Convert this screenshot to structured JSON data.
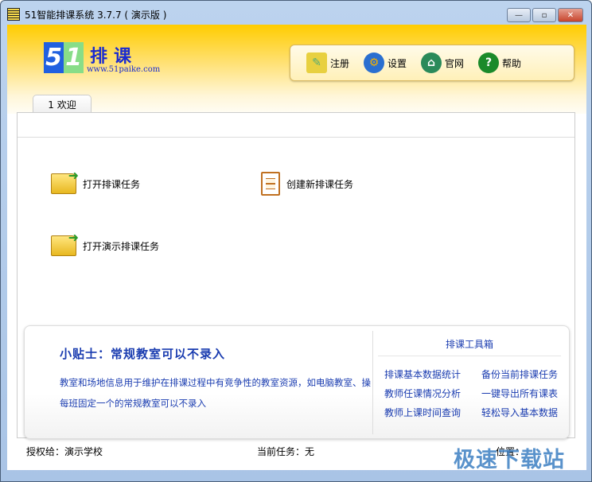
{
  "window": {
    "title": "51智能排课系统 3.7.7 ( 演示版 )",
    "controls": [
      "—",
      "▫",
      "✕"
    ]
  },
  "logo": {
    "digit1": "5",
    "digit2": "1",
    "text": "排课",
    "url": "www.51paike.com"
  },
  "toolbar": [
    {
      "label": "注册",
      "icon": "register-pen-icon",
      "color": "#e8d040"
    },
    {
      "label": "设置",
      "icon": "gear-icon",
      "color": "#2a6fd0"
    },
    {
      "label": "官网",
      "icon": "globe-home-icon",
      "color": "#2a8a5a"
    },
    {
      "label": "帮助",
      "icon": "help-icon",
      "color": "#1a8a2a"
    }
  ],
  "tabs": [
    {
      "label": "1 欢迎"
    }
  ],
  "actions": {
    "open": "打开排课任务",
    "create": "创建新排课任务",
    "open_demo": "打开演示排课任务"
  },
  "tip": {
    "title": "小贴士：常规教室可以不录入",
    "line1": "教室和场地信息用于维护在排课过程中有竞争性的教室资源，如电脑教室、操",
    "line2": "每班固定一个的常规教室可以不录入"
  },
  "toolbox": {
    "title": "排课工具箱",
    "items": [
      "排课基本数据统计",
      "备份当前排课任务",
      "教师任课情况分析",
      "一键导出所有课表",
      "教师上课时间查询",
      "轻松导入基本数据"
    ]
  },
  "status": {
    "licensed": "授权给：演示学校",
    "task": "当前任务：无",
    "position": "位置："
  },
  "watermark": "极速下载站"
}
